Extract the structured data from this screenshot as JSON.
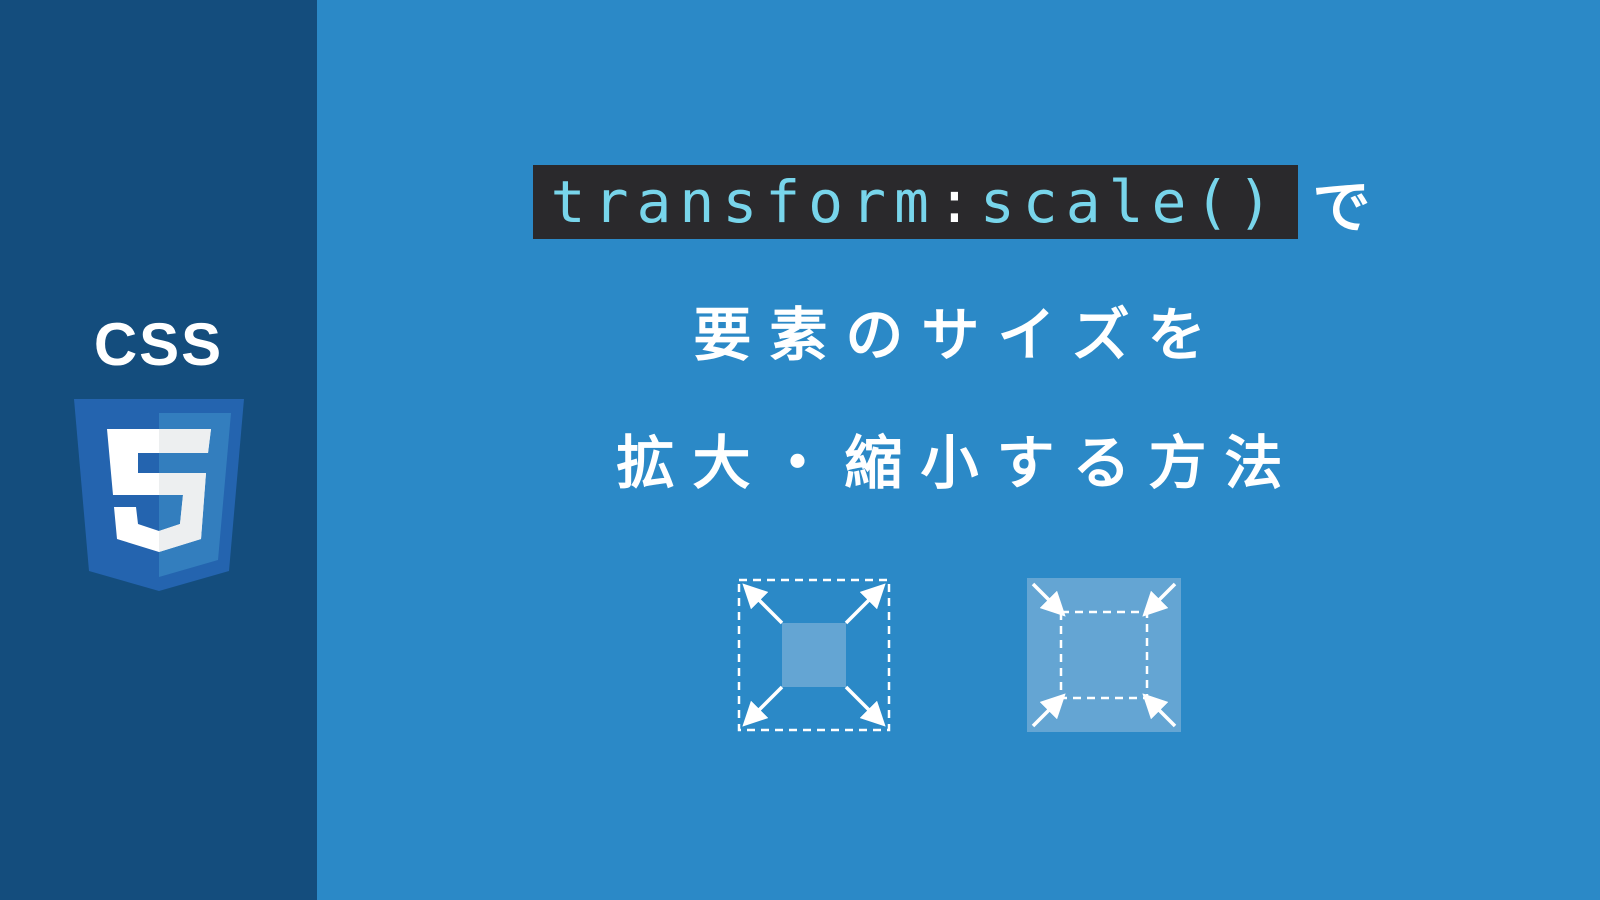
{
  "sidebar": {
    "label": "CSS"
  },
  "title": {
    "code": {
      "property": "transform",
      "colon": ":",
      "function": "scale",
      "parens": "()"
    },
    "suffix": "で",
    "line2": "要素のサイズを",
    "line3": "拡大・縮小する方法"
  },
  "colors": {
    "sidebar_bg": "#144d7d",
    "main_bg": "#2b89c7",
    "code_bg": "#2a292c",
    "code_token": "#78d5eb",
    "text": "#ffffff"
  }
}
